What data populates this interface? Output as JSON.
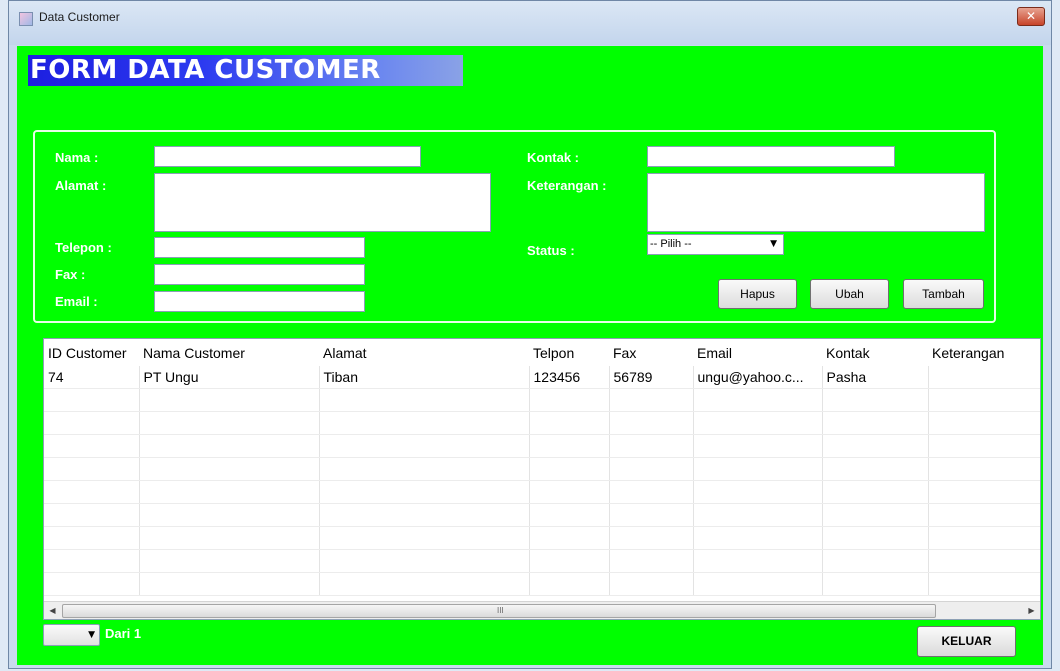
{
  "window": {
    "title": "Data Customer",
    "close_icon": "close-icon"
  },
  "header": {
    "title": "FORM DATA CUSTOMER"
  },
  "form": {
    "nama_label": "Nama :",
    "alamat_label": "Alamat :",
    "telepon_label": "Telepon :",
    "fax_label": "Fax :",
    "email_label": "Email :",
    "kontak_label": "Kontak :",
    "keterangan_label": "Keterangan :",
    "status_label": "Status :",
    "nama_value": "",
    "alamat_value": "",
    "telepon_value": "",
    "fax_value": "",
    "email_value": "",
    "kontak_value": "",
    "keterangan_value": "",
    "status_selected": "-- Pilih --"
  },
  "buttons": {
    "hapus": "Hapus",
    "ubah": "Ubah",
    "tambah": "Tambah",
    "keluar": "KELUAR"
  },
  "table": {
    "columns": [
      "ID Customer",
      "Nama Customer",
      "Alamat",
      "Telpon",
      "Fax",
      "Email",
      "Kontak",
      "Keterangan"
    ],
    "rows": [
      [
        "74",
        "PT Ungu",
        "Tiban",
        "123456",
        "56789",
        "ungu@yahoo.c...",
        "Pasha",
        ""
      ]
    ]
  },
  "pagination": {
    "page_selected": "",
    "of_label": "Dari 1"
  },
  "colors": {
    "form_background": "#00ff00",
    "title_bar": "#c9daee",
    "header_title": "#1d1fe0"
  }
}
